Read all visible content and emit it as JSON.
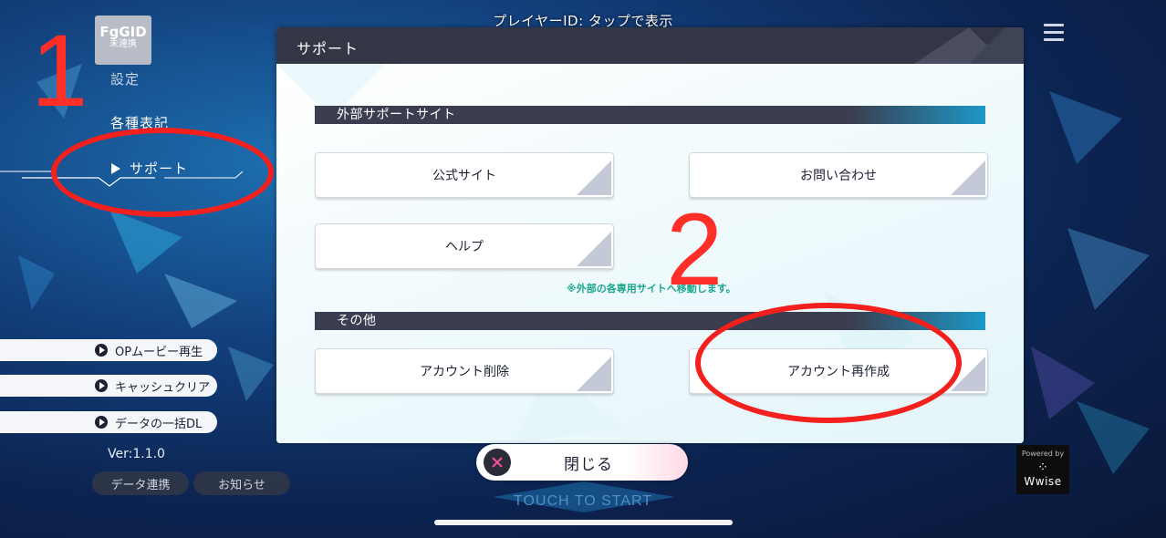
{
  "top_bar": {
    "player_id": "プレイヤーID: タップで表示"
  },
  "sidebar": {
    "fggid_title": "FgGID",
    "fggid_status": "未連携",
    "settings_label": "設定",
    "items": [
      {
        "label": "各種表記"
      },
      {
        "label": "サポート",
        "selected": true
      }
    ]
  },
  "left_actions": [
    {
      "label": "OPムービー再生"
    },
    {
      "label": "キャッシュクリア"
    },
    {
      "label": "データの一括DL"
    }
  ],
  "version": "Ver:1.1.0",
  "bottom_buttons": {
    "data_link": "データ連携",
    "notice": "お知らせ"
  },
  "modal": {
    "title": "サポート",
    "sections": [
      {
        "label": "外部サポートサイト",
        "buttons": [
          "公式サイト",
          "お問い合わせ",
          "ヘルプ"
        ],
        "note": "※外部の各専用サイトへ移動します。"
      },
      {
        "label": "その他",
        "buttons": [
          "アカウント削除",
          "アカウント再作成"
        ]
      }
    ]
  },
  "close_button": {
    "label": "閉じる"
  },
  "touch_to_start": "TOUCH TO START",
  "wwise": {
    "powered_by": "Powered by",
    "brand": "Wwise"
  },
  "annotations": {
    "one": "1",
    "two": "2",
    "color": "#f3201d"
  },
  "colors": {
    "accent": "#1c98c7",
    "header": "#333645",
    "note": "#1aa68c"
  }
}
